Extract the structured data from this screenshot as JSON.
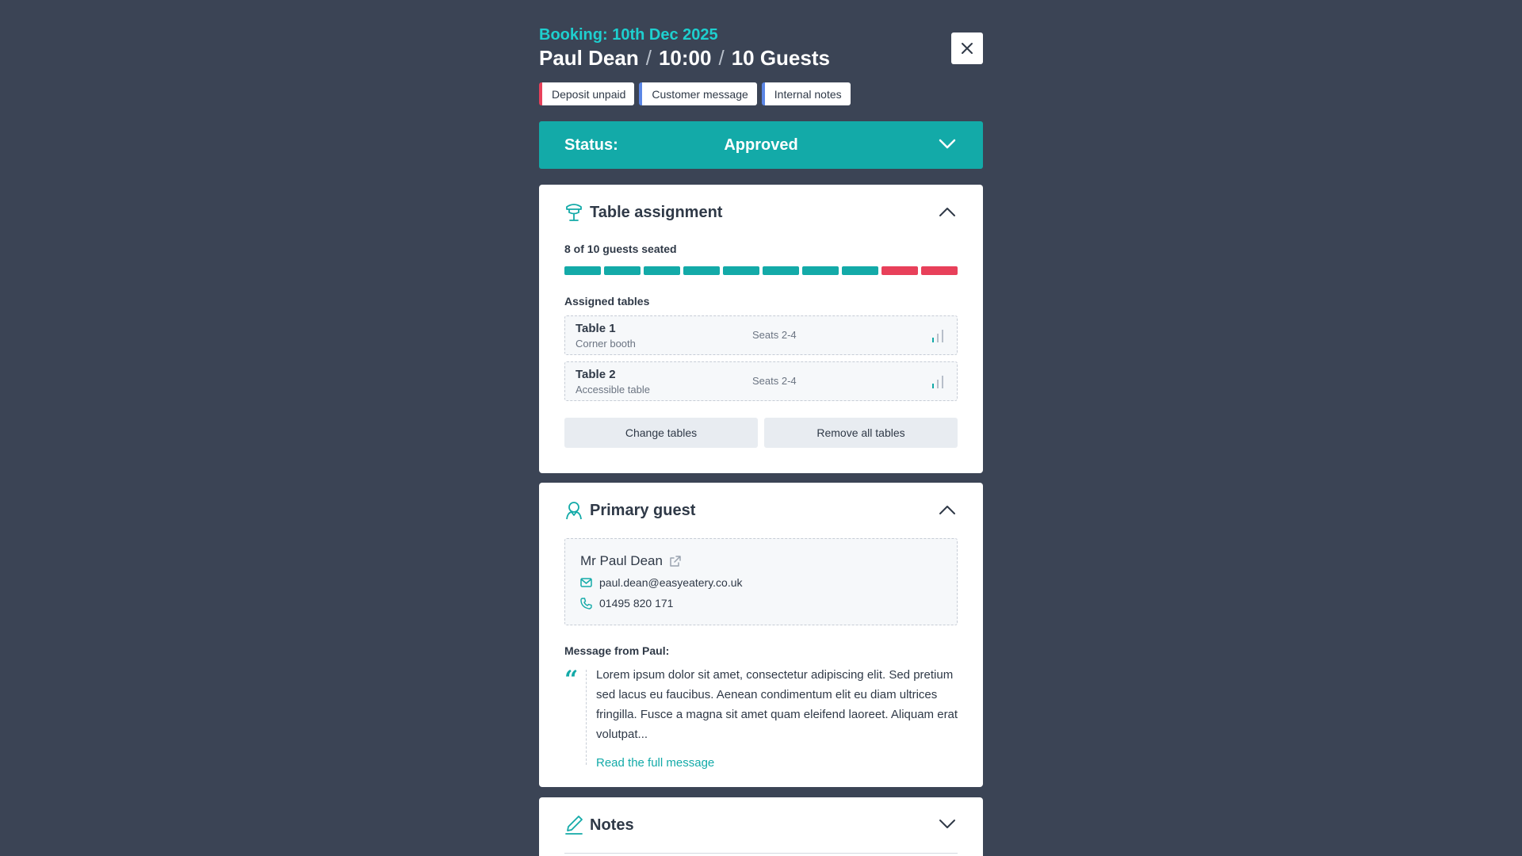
{
  "header": {
    "booking_date": "Booking: 10th Dec 2025",
    "guest_name": "Paul Dean",
    "separator": "/",
    "time": "10:00",
    "guests": "10 Guests"
  },
  "tags": [
    {
      "label": "Deposit unpaid",
      "color": "#e8405a"
    },
    {
      "label": "Customer message",
      "color": "#5b86e5"
    },
    {
      "label": "Internal notes",
      "color": "#5b86e5"
    }
  ],
  "status": {
    "label": "Status:",
    "value": "Approved"
  },
  "table_assignment": {
    "title": "Table assignment",
    "icon": "table-lamp-icon",
    "seated_text": "8 of 10 guests seated",
    "seated": 8,
    "total": 10,
    "assigned_label": "Assigned tables",
    "tables": [
      {
        "name": "Table 1",
        "description": "Corner booth",
        "seats": "Seats 2-4"
      },
      {
        "name": "Table 2",
        "description": "Accessible table",
        "seats": "Seats 2-4"
      }
    ],
    "change_button": "Change tables",
    "remove_button": "Remove all tables"
  },
  "primary_guest": {
    "title": "Primary guest",
    "icon": "person-icon",
    "name": "Mr Paul Dean",
    "email": "paul.dean@easyeatery.co.uk",
    "phone": "01495 820 171",
    "message_label": "Message from Paul:",
    "message": "Lorem ipsum dolor sit amet, consectetur adipiscing elit. Sed pretium sed lacus eu faucibus. Aenean condimentum elit eu diam ultrices fringilla. Fusce a magna sit amet quam eleifend laoreet. Aliquam erat volutpat...",
    "read_more": "Read the full message"
  },
  "notes": {
    "title": "Notes",
    "icon": "pen-icon"
  },
  "colors": {
    "background": "#3b4455",
    "accent": "#13aaa8",
    "heading_accent": "#1ecfcf",
    "warning": "#e8405a",
    "info": "#5b86e5"
  }
}
